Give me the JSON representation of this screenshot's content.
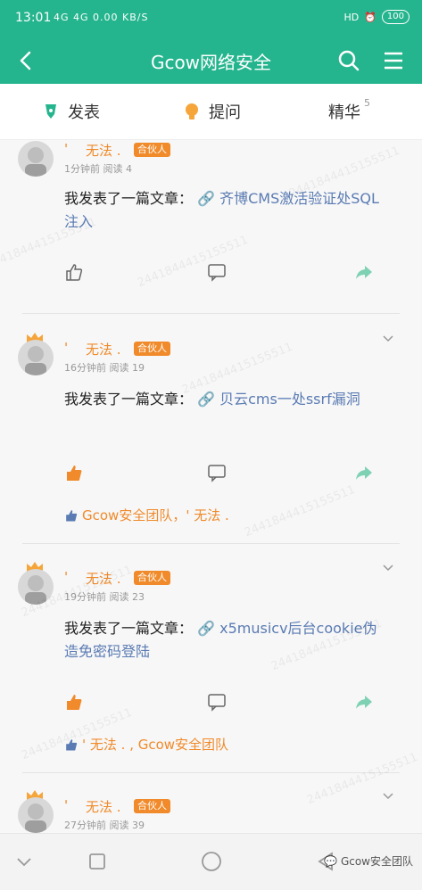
{
  "status": {
    "time": "13:01",
    "net": "4G 4G 0.00 KB/S",
    "battery": "100"
  },
  "header": {
    "title": "Gcow网络安全"
  },
  "actions": {
    "publish": "发表",
    "ask": "提问",
    "elite": "精华",
    "elite_count": "5"
  },
  "posts": [
    {
      "quote": "'",
      "username": "无法 .",
      "badge": "合伙人",
      "time": "1分钟前",
      "reads": "阅读 4",
      "prefix": "我发表了一篇文章：",
      "link": "齐博CMS激活验证处SQL注入"
    },
    {
      "quote": "'",
      "username": "无法 .",
      "badge": "合伙人",
      "time": "16分钟前",
      "reads": "阅读 19",
      "prefix": "我发表了一篇文章：",
      "link": "贝云cms一处ssrf漏洞",
      "likers": "Gcow安全团队，'  无法 ."
    },
    {
      "quote": "'",
      "username": "无法 .",
      "badge": "合伙人",
      "time": "19分钟前",
      "reads": "阅读 23",
      "prefix": "我发表了一篇文章：",
      "link": "x5musicv后台cookie伪造免密码登陆",
      "likers": "'  无法 . , Gcow安全团队"
    },
    {
      "quote": "'",
      "username": "无法 .",
      "badge": "合伙人",
      "time": "27分钟前",
      "reads": "阅读 39"
    }
  ],
  "watermark": "2441844415155511",
  "footer": {
    "brand": "Gcow安全团队"
  },
  "colors": {
    "primary": "#25b58e",
    "accent": "#f08a2a",
    "link": "#5a7bb3"
  }
}
